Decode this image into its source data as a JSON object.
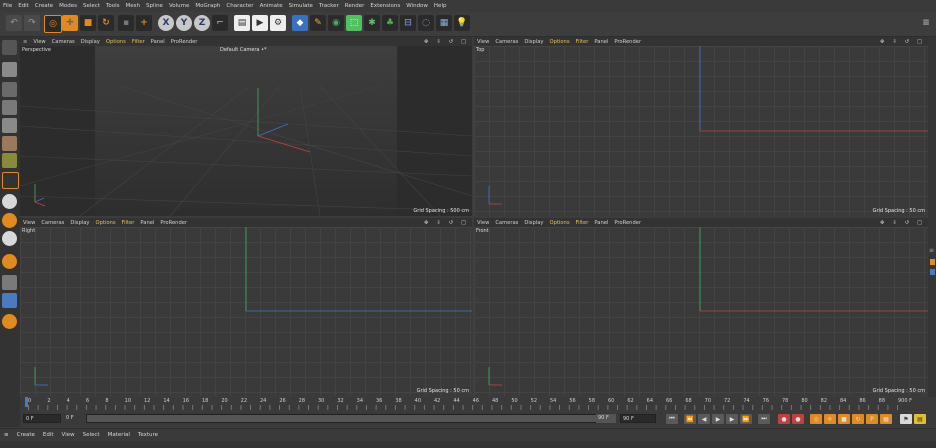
{
  "menu": [
    "File",
    "Edit",
    "Create",
    "Modes",
    "Select",
    "Tools",
    "Mesh",
    "Spline",
    "Volume",
    "MoGraph",
    "Character",
    "Animate",
    "Simulate",
    "Tracker",
    "Render",
    "Extensions",
    "Window",
    "Help"
  ],
  "viewport_menu": {
    "items": [
      "View",
      "Cameras",
      "Display",
      "Options",
      "Filter",
      "Panel",
      "ProRender"
    ],
    "active_items": [
      "Options",
      "Filter"
    ]
  },
  "viewports": [
    {
      "id": "perspective",
      "label": "Perspective",
      "camera": "Default Camera •*",
      "grid_spacing": "Grid Spacing : 500 cm"
    },
    {
      "id": "top",
      "label": "Top",
      "camera": "",
      "grid_spacing": "Grid Spacing : 50 cm"
    },
    {
      "id": "right",
      "label": "Right",
      "camera": "",
      "grid_spacing": "Grid Spacing : 50 cm"
    },
    {
      "id": "front",
      "label": "Front",
      "camera": "",
      "grid_spacing": "Grid Spacing : 50 cm"
    }
  ],
  "timeline": {
    "ticks": [
      "0",
      "2",
      "4",
      "6",
      "8",
      "10",
      "12",
      "14",
      "16",
      "18",
      "20",
      "22",
      "24",
      "26",
      "28",
      "30",
      "32",
      "34",
      "36",
      "38",
      "40",
      "42",
      "44",
      "46",
      "48",
      "50",
      "52",
      "54",
      "56",
      "58",
      "60",
      "62",
      "64",
      "66",
      "68",
      "70",
      "72",
      "74",
      "76",
      "78",
      "80",
      "82",
      "84",
      "86",
      "88",
      "90"
    ],
    "current_frame": "0 F",
    "start_field": "0 F",
    "start_range": "0 F",
    "end_range": "90 F",
    "end_field": "90 F",
    "end_label": "0 F"
  },
  "material_menu": [
    "Create",
    "Edit",
    "View",
    "Select",
    "Material",
    "Texture"
  ],
  "colors": {
    "axis_x": "#c84040",
    "axis_y": "#40b060",
    "axis_z": "#4070d0",
    "active_menu": "#e0c060"
  }
}
